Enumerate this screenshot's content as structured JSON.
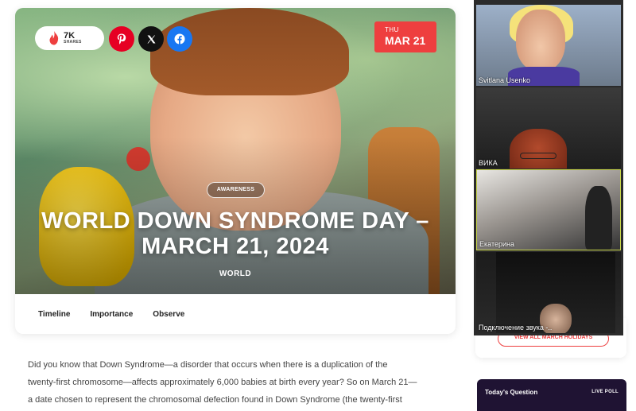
{
  "hero": {
    "shares_count": "7K",
    "shares_label": "SHARES",
    "date_dow": "THU",
    "date_md": "MAR 21",
    "tag": "AWARENESS",
    "title_line1": "WORLD DOWN SYNDROME DAY –",
    "title_line2": "MARCH 21, 2024",
    "category": "WORLD"
  },
  "social": {
    "pinterest": "pinterest-icon",
    "x": "x-icon",
    "facebook": "facebook-icon"
  },
  "tabs": [
    "Timeline",
    "Importance",
    "Observe"
  ],
  "article": {
    "lines": [
      "Did you know that Down Syndrome—a disorder that occurs when there is a duplication of the",
      "twenty-first chromosome—affects approximately 6,000 babies at birth every year? So on March 21—",
      "a date chosen to represent the chromosomal defection found in Down Syndrome (the twenty-first"
    ]
  },
  "sidebar": {
    "view_all_label": "VIEW ALL MARCH HOLIDAYS",
    "poll_title": "Today's Question",
    "poll_badge": "LIVE POLL"
  },
  "video_call": {
    "participants": [
      "Svitlana Usenko",
      "ВИКА",
      "Екатерина",
      "Подключение звука -.."
    ]
  },
  "colors": {
    "accent_red": "#ee3f3f",
    "active_speaker_border": "#c8d64a",
    "poll_bg": "#1f1333"
  }
}
